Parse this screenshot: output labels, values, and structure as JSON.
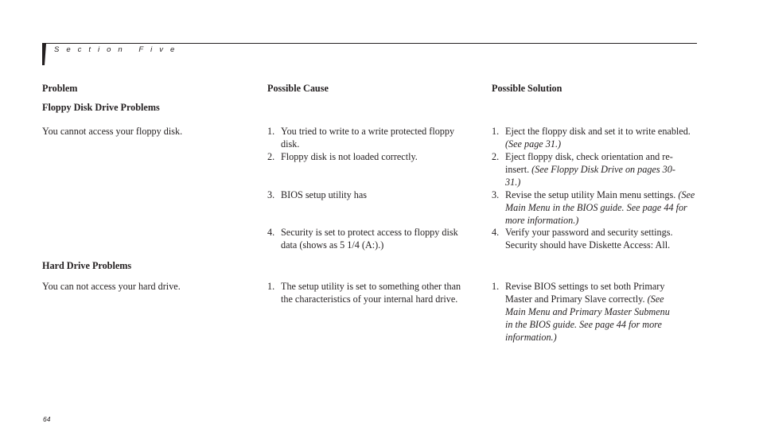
{
  "header": {
    "section_label": "Section Five"
  },
  "columns": {
    "problem": "Problem",
    "cause": "Possible Cause",
    "solution": "Possible Solution"
  },
  "groups": [
    {
      "title": "Floppy Disk Drive Problems",
      "problem": "You cannot access your floppy disk.",
      "causes": [
        {
          "num": "1.",
          "text": "You tried to write to a write protected floppy disk."
        },
        {
          "num": "2.",
          "text": "Floppy disk is not loaded correctly."
        },
        {
          "num": "3.",
          "text": "BIOS setup utility has"
        },
        {
          "num": "4.",
          "text": "Security is set to protect access to floppy disk data (shows as 5 1/4 (A:).)"
        }
      ],
      "solutions": [
        {
          "num": "1.",
          "text": "Eject the floppy disk and set it to write enabled.",
          "ref": "(See page 31.)"
        },
        {
          "num": "2.",
          "text": "Eject floppy disk, check orientation and re-insert.",
          "ref": "(See Floppy Disk Drive on pages 30-31.)"
        },
        {
          "num": "3.",
          "text": "Revise the setup utility Main menu settings.",
          "ref": "(See Main Menu in the BIOS guide. See page 44 for more information.)"
        },
        {
          "num": "4.",
          "text": "Verify your password and security settings. Security should have Diskette Access: All.",
          "ref": ""
        }
      ]
    },
    {
      "title": "Hard Drive Problems",
      "problem": "You can not access your hard drive.",
      "causes": [
        {
          "num": "1.",
          "text": "The setup utility is set to something other than the characteristics of your internal hard drive."
        }
      ],
      "solutions": [
        {
          "num": "1.",
          "text": "Revise BIOS settings to set both Primary Master and Primary Slave correctly.",
          "ref": "(See Main Menu and Primary Master Submenu in the BIOS guide. See page 44 for more information.)"
        }
      ]
    }
  ],
  "footer": {
    "page_number": "64"
  }
}
